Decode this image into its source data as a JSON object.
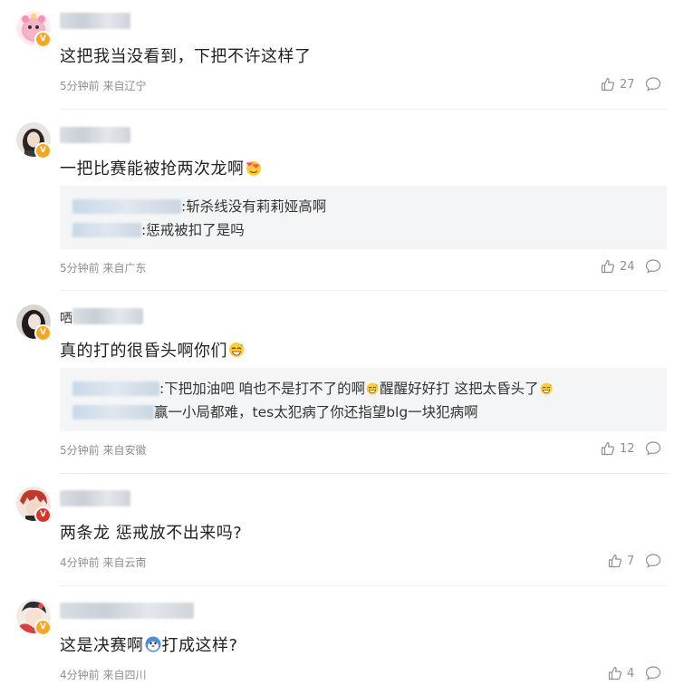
{
  "comments": [
    {
      "text": "这把我当没看到，下把不许这样了",
      "meta": "5分钟前 来自辽宁",
      "likes": "27",
      "badge": "V",
      "replies": []
    },
    {
      "text": "一把比赛能被抢两次龙啊",
      "meta": "5分钟前 来自广东",
      "likes": "24",
      "badge": "V",
      "replies": [
        {
          "text": ":斩杀线没有莉莉娅高啊"
        },
        {
          "text": ":惩戒被扣了是吗"
        }
      ]
    },
    {
      "name_prefix": "哂",
      "text": "真的打的很昏头啊你们",
      "meta": "5分钟前 来自安徽",
      "likes": "12",
      "badge": "V",
      "replies": [
        {
          "text": ":下把加油吧 咱也不是打不了的啊",
          "text2": "醒醒好好打 这把太昏头了"
        },
        {
          "text": "赢一小局都难，tes太犯病了你还指望blg一块犯病啊"
        }
      ]
    },
    {
      "text": "两条龙 惩戒放不出来吗?",
      "meta": "4分钟前 来自云南",
      "likes": "7",
      "badge": "V",
      "replies": []
    },
    {
      "text": "这是决赛啊",
      "text2": "打成这样?",
      "meta": "4分钟前 来自四川",
      "likes": "4",
      "badge": "V",
      "replies": []
    }
  ],
  "colors": {
    "gold_badge": "#f5a623",
    "red_badge": "#e0322b",
    "meta": "#8f8f8f",
    "reply_bg": "#f4f5f6"
  },
  "icons": [
    "thumbs-up-icon",
    "comment-icon",
    "emoji-grin-sweat-icon",
    "emoji-heart-face-icon",
    "emoji-doge-icon"
  ]
}
